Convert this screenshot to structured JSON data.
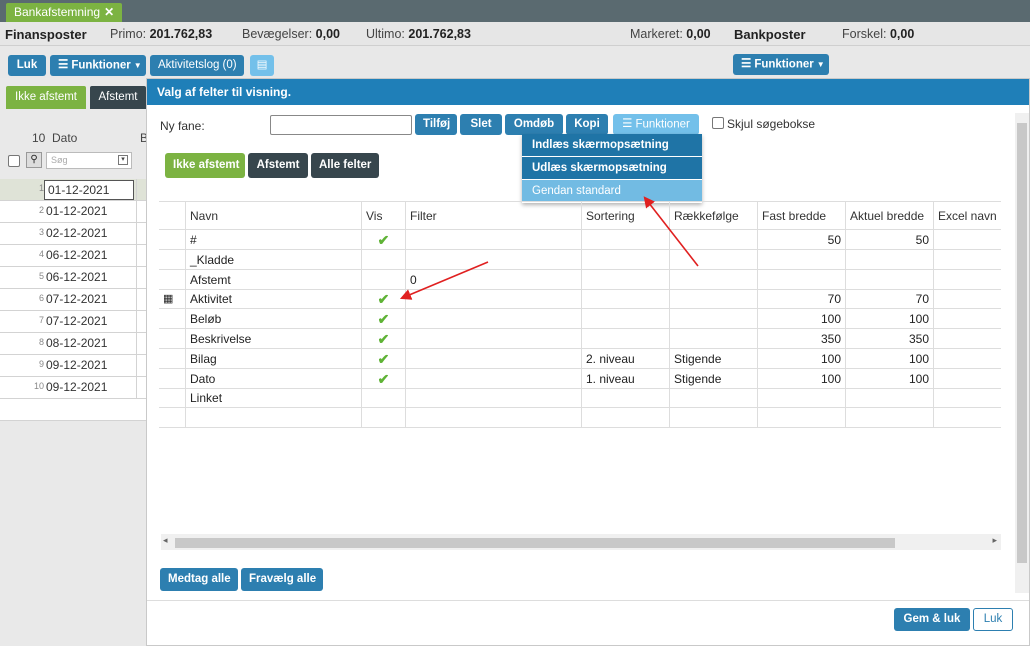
{
  "tab": {
    "label": "Bankafstemning"
  },
  "summary": {
    "finansposter": "Finansposter",
    "primo_label": "Primo:",
    "primo_value": "201.762,83",
    "bev_label": "Bevægelser:",
    "bev_value": "0,00",
    "ultimo_label": "Ultimo:",
    "ultimo_value": "201.762,83",
    "markeret_label": "Markeret:",
    "markeret_value": "0,00",
    "bankposter": "Bankposter",
    "forskel_label": "Forskel:",
    "forskel_value": "0,00"
  },
  "toolbar": {
    "luk": "Luk",
    "funktioner": "Funktioner",
    "aktivitetslog": "Aktivitetslog (0)",
    "funktioner_right": "Funktioner"
  },
  "left": {
    "tab_ikke": "Ikke afstemt",
    "tab_afstemt": "Afstemt",
    "count": "10",
    "col_dato": "Dato",
    "col_b": "B",
    "search_placeholder": "Søg",
    "rows": [
      {
        "n": "1",
        "d": "01-12-2021"
      },
      {
        "n": "2",
        "d": "01-12-2021"
      },
      {
        "n": "3",
        "d": "02-12-2021"
      },
      {
        "n": "4",
        "d": "06-12-2021"
      },
      {
        "n": "5",
        "d": "06-12-2021"
      },
      {
        "n": "6",
        "d": "07-12-2021"
      },
      {
        "n": "7",
        "d": "07-12-2021"
      },
      {
        "n": "8",
        "d": "08-12-2021"
      },
      {
        "n": "9",
        "d": "09-12-2021"
      },
      {
        "n": "10",
        "d": "09-12-2021"
      }
    ]
  },
  "modal": {
    "title": "Valg af felter til visning.",
    "ny_fane": "Ny fane:",
    "btn_tilfoej": "Tilføj",
    "btn_slet": "Slet",
    "btn_omdoeb": "Omdøb",
    "btn_kopi": "Kopi",
    "btn_funktioner": "Funktioner",
    "skjul": "Skjul søgebokse",
    "menu": [
      "Indlæs skærmopsætning",
      "Udlæs skærmopsætning",
      "Gendan standard"
    ],
    "tabs": [
      "Ikke afstemt",
      "Afstemt",
      "Alle felter"
    ],
    "headers": [
      "Navn",
      "Vis",
      "Filter",
      "Sortering",
      "Rækkefølge",
      "Fast bredde",
      "Aktuel bredde",
      "Excel navn"
    ],
    "check_glyph": "✔",
    "rows": [
      {
        "navn": "#",
        "vis": true,
        "filter": "",
        "sort": "",
        "order": "",
        "fast": "50",
        "aktuel": "50",
        "icon": ""
      },
      {
        "navn": "_Kladde",
        "vis": false,
        "filter": "",
        "sort": "",
        "order": "",
        "fast": "",
        "aktuel": "",
        "icon": ""
      },
      {
        "navn": "Afstemt",
        "vis": false,
        "filter": "0",
        "sort": "",
        "order": "",
        "fast": "",
        "aktuel": "",
        "icon": ""
      },
      {
        "navn": "Aktivitet",
        "vis": true,
        "filter": "",
        "sort": "",
        "order": "",
        "fast": "70",
        "aktuel": "70",
        "icon": "calculator-icon"
      },
      {
        "navn": "Beløb",
        "vis": true,
        "filter": "",
        "sort": "",
        "order": "",
        "fast": "100",
        "aktuel": "100",
        "icon": ""
      },
      {
        "navn": "Beskrivelse",
        "vis": true,
        "filter": "",
        "sort": "",
        "order": "",
        "fast": "350",
        "aktuel": "350",
        "icon": ""
      },
      {
        "navn": "Bilag",
        "vis": true,
        "filter": "",
        "sort": "2. niveau",
        "order": "Stigende",
        "fast": "100",
        "aktuel": "100",
        "icon": ""
      },
      {
        "navn": "Dato",
        "vis": true,
        "filter": "",
        "sort": "1. niveau",
        "order": "Stigende",
        "fast": "100",
        "aktuel": "100",
        "icon": ""
      },
      {
        "navn": "Linket",
        "vis": false,
        "filter": "",
        "sort": "",
        "order": "",
        "fast": "",
        "aktuel": "",
        "icon": ""
      },
      {
        "navn": "",
        "vis": false,
        "filter": "",
        "sort": "",
        "order": "",
        "fast": "",
        "aktuel": "",
        "icon": ""
      }
    ],
    "btn_medtag": "Medtag alle",
    "btn_fravaelg": "Fravælg alle",
    "btn_gem": "Gem & luk",
    "btn_luk": "Luk"
  },
  "colors": {
    "accent": "#2d7fb0",
    "green": "#7cb342",
    "header": "#1f7fb8",
    "arrow": "#e02020"
  }
}
